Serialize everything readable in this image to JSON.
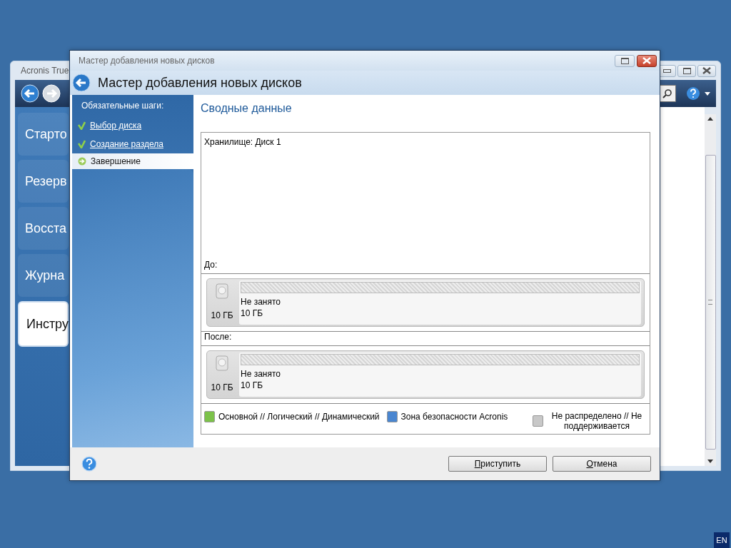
{
  "background_window": {
    "title": "Acronis True",
    "sidebar": [
      {
        "label": "Старто",
        "selected": false
      },
      {
        "label": "Резерв",
        "selected": false
      },
      {
        "label": "Восста",
        "selected": false
      },
      {
        "label": "Журна",
        "selected": false
      },
      {
        "label": "Инстру",
        "selected": true
      }
    ]
  },
  "dialog": {
    "title": "Мастер добавления новых дисков",
    "header": "Мастер добавления новых дисков",
    "steps_heading": "Обязательные шаги:",
    "steps": [
      {
        "label": "Выбор диска",
        "done": true,
        "selected": false
      },
      {
        "label": "Создание раздела",
        "done": true,
        "selected": false
      },
      {
        "label": "Завершение",
        "done": false,
        "selected": true
      }
    ],
    "section_title": "Сводные данные",
    "storage": "Хранилище: Диск 1",
    "disks": [
      {
        "caption": "До:",
        "capacity": "10 ГБ",
        "partition": "Не занято",
        "size": "10 ГБ"
      },
      {
        "caption": "После:",
        "capacity": "10 ГБ",
        "partition": "Не занято",
        "size": "10 ГБ"
      }
    ],
    "legend": [
      {
        "label": "Основной // Логический // Динамический",
        "color": "#7cc24a"
      },
      {
        "label": "Зона безопасности Acronis",
        "color": "#4a86d0"
      },
      {
        "label": "Не распределено // Не поддерживается",
        "color": "#c8c8c8"
      }
    ],
    "buttons": [
      "Приступить",
      "Отмена"
    ]
  },
  "language": "EN"
}
